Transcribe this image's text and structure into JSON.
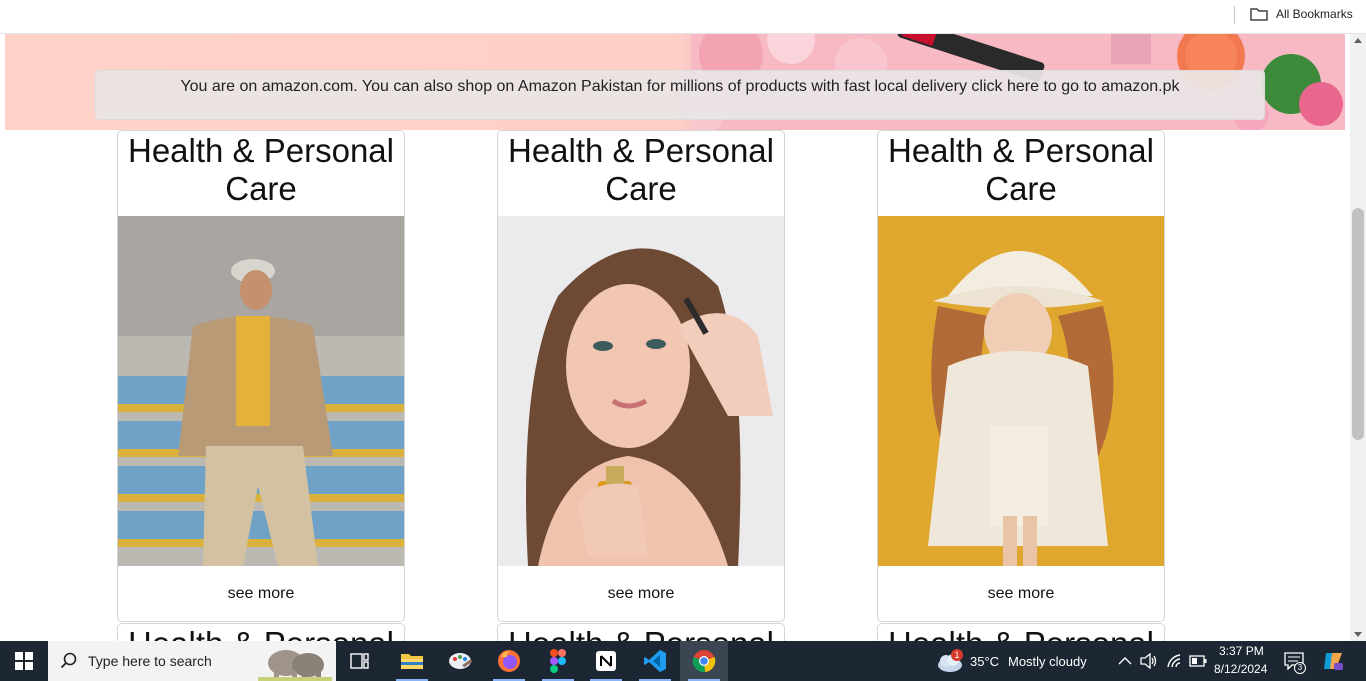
{
  "bookmarks_bar": {
    "all_bookmarks_label": "All Bookmarks"
  },
  "hero": {
    "notice": "You are on amazon.com. You can also shop on Amazon Pakistan for millions of products with fast local delivery click here to go to amazon.pk"
  },
  "cards": [
    {
      "title": "Health & Personal Care",
      "link": "see more",
      "image": "man-standing-in-stadium"
    },
    {
      "title": "Health & Personal Care",
      "link": "see more",
      "image": "woman-applying-serum"
    },
    {
      "title": "Health & Personal Care",
      "link": "see more",
      "image": "girl-in-bucket-hat"
    },
    {
      "title": "Health & Personal Care"
    },
    {
      "title": "Health & Personal Care"
    },
    {
      "title": "Health & Personal Care"
    }
  ],
  "taskbar": {
    "search_placeholder": "Type here to search",
    "weather_temp": "35°C",
    "weather_desc": "Mostly cloudy",
    "weather_badge": "1",
    "time": "3:37 PM",
    "date": "8/12/2024",
    "notification_count": "3",
    "apps": [
      "task-view",
      "file-explorer",
      "paint",
      "firefox",
      "figma",
      "notion",
      "vscode",
      "chrome"
    ]
  },
  "colors": {
    "taskbar": "#1c2733",
    "hero": "#ffd2c9",
    "accent": "#8ab4f8"
  }
}
